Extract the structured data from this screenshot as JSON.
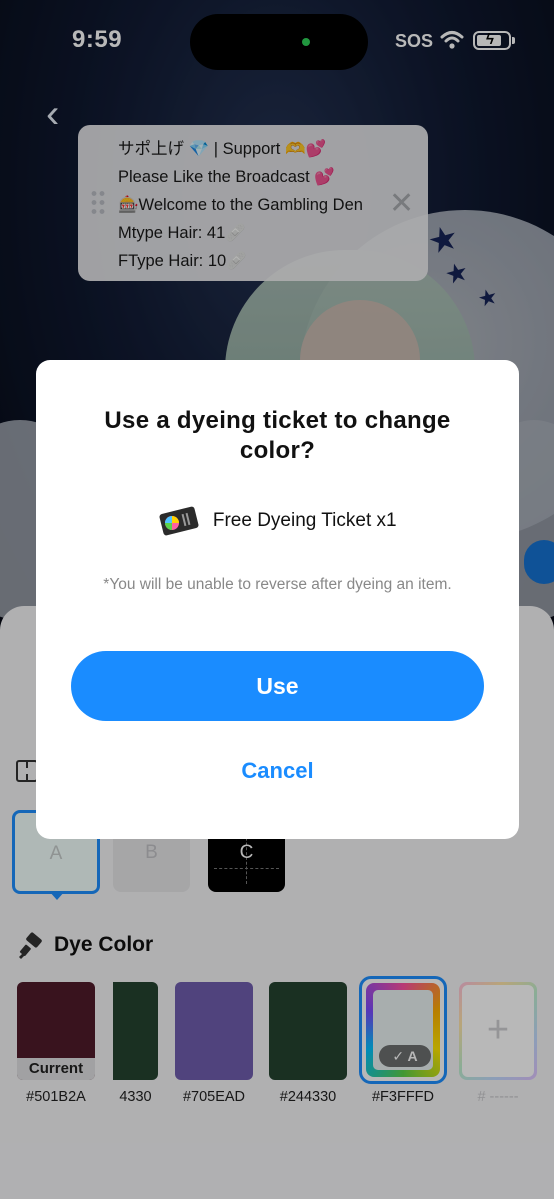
{
  "status_bar": {
    "time": "9:59",
    "sos": "SOS"
  },
  "announcement": {
    "lines": [
      "サポ上げ 💎 | Support 🫶💕",
      "Please Like the Broadcast 💕",
      "🎰Welcome to the Gambling Den",
      "Mtype Hair: 41🩹",
      "FType Hair: 10🩹"
    ]
  },
  "parts": {
    "a": "A",
    "b": "B",
    "c": "C"
  },
  "dye": {
    "title": "Dye Color",
    "current_label": "Current",
    "swatches": [
      {
        "hex": "#501B2A",
        "label": "#501B2A"
      },
      {
        "hex": "#244330",
        "label": "4330"
      },
      {
        "hex": "#705EAD",
        "label": "#705EAD"
      },
      {
        "hex": "#244330",
        "label": "#244330"
      },
      {
        "hex": "#F3FFFD",
        "label": "#F3FFFD",
        "tag": "✓ A",
        "selected": true
      },
      {
        "hex": "",
        "label": "# ------"
      }
    ],
    "add_symbol": "+"
  },
  "modal": {
    "title": "Use a dyeing ticket to change color?",
    "ticket_text": "Free Dyeing Ticket x1",
    "warning": "*You will be unable to reverse after dyeing an item.",
    "use_label": "Use",
    "cancel_label": "Cancel"
  },
  "colors": {
    "accent": "#1A8CFF",
    "modal_bg": "#FFFFFF",
    "sheet_bg": "#F4F4F6"
  }
}
